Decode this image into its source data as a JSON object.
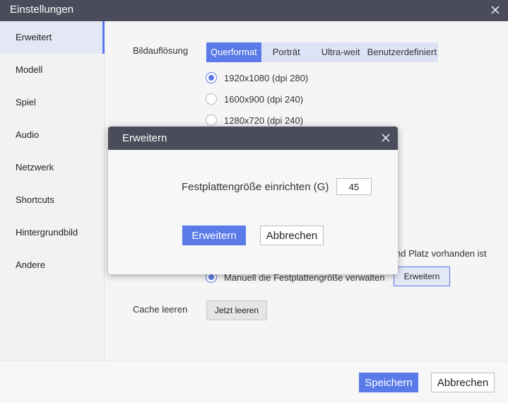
{
  "window": {
    "title": "Einstellungen",
    "close_icon": "close-icon"
  },
  "sidebar": {
    "items": [
      {
        "label": "Erweitert",
        "active": true
      },
      {
        "label": "Modell"
      },
      {
        "label": "Spiel"
      },
      {
        "label": "Audio"
      },
      {
        "label": "Netzwerk"
      },
      {
        "label": "Shortcuts"
      },
      {
        "label": "Hintergrundbild"
      },
      {
        "label": "Andere"
      }
    ]
  },
  "resolution": {
    "label": "Bildauflösung",
    "tabs": [
      {
        "label": "Querformat",
        "active": true
      },
      {
        "label": "Porträt"
      },
      {
        "label": "Ultra-weit"
      },
      {
        "label": "Benutzerdefiniert"
      }
    ],
    "options": [
      {
        "label": "1920x1080  (dpi 280)",
        "checked": true
      },
      {
        "label": "1600x900  (dpi 240)",
        "checked": false
      },
      {
        "label": "1280x720  (dpi 240)",
        "checked": false
      }
    ]
  },
  "disk": {
    "partial_text": "nd Platz vorhanden ist",
    "manual_label": "Manuell die Festplattengröße verwalten",
    "expand_button": "Erweitern"
  },
  "cache": {
    "label": "Cache leeren",
    "button": "Jetzt leeren"
  },
  "footer": {
    "save": "Speichern",
    "cancel": "Abbrechen"
  },
  "modal": {
    "title": "Erweitern",
    "field_label": "Festplattengröße einrichten (G)",
    "field_value": "45",
    "confirm": "Erweitern",
    "cancel": "Abbrechen"
  },
  "colors": {
    "accent": "#5a7ae8",
    "titlebar": "#4a4c5b"
  }
}
